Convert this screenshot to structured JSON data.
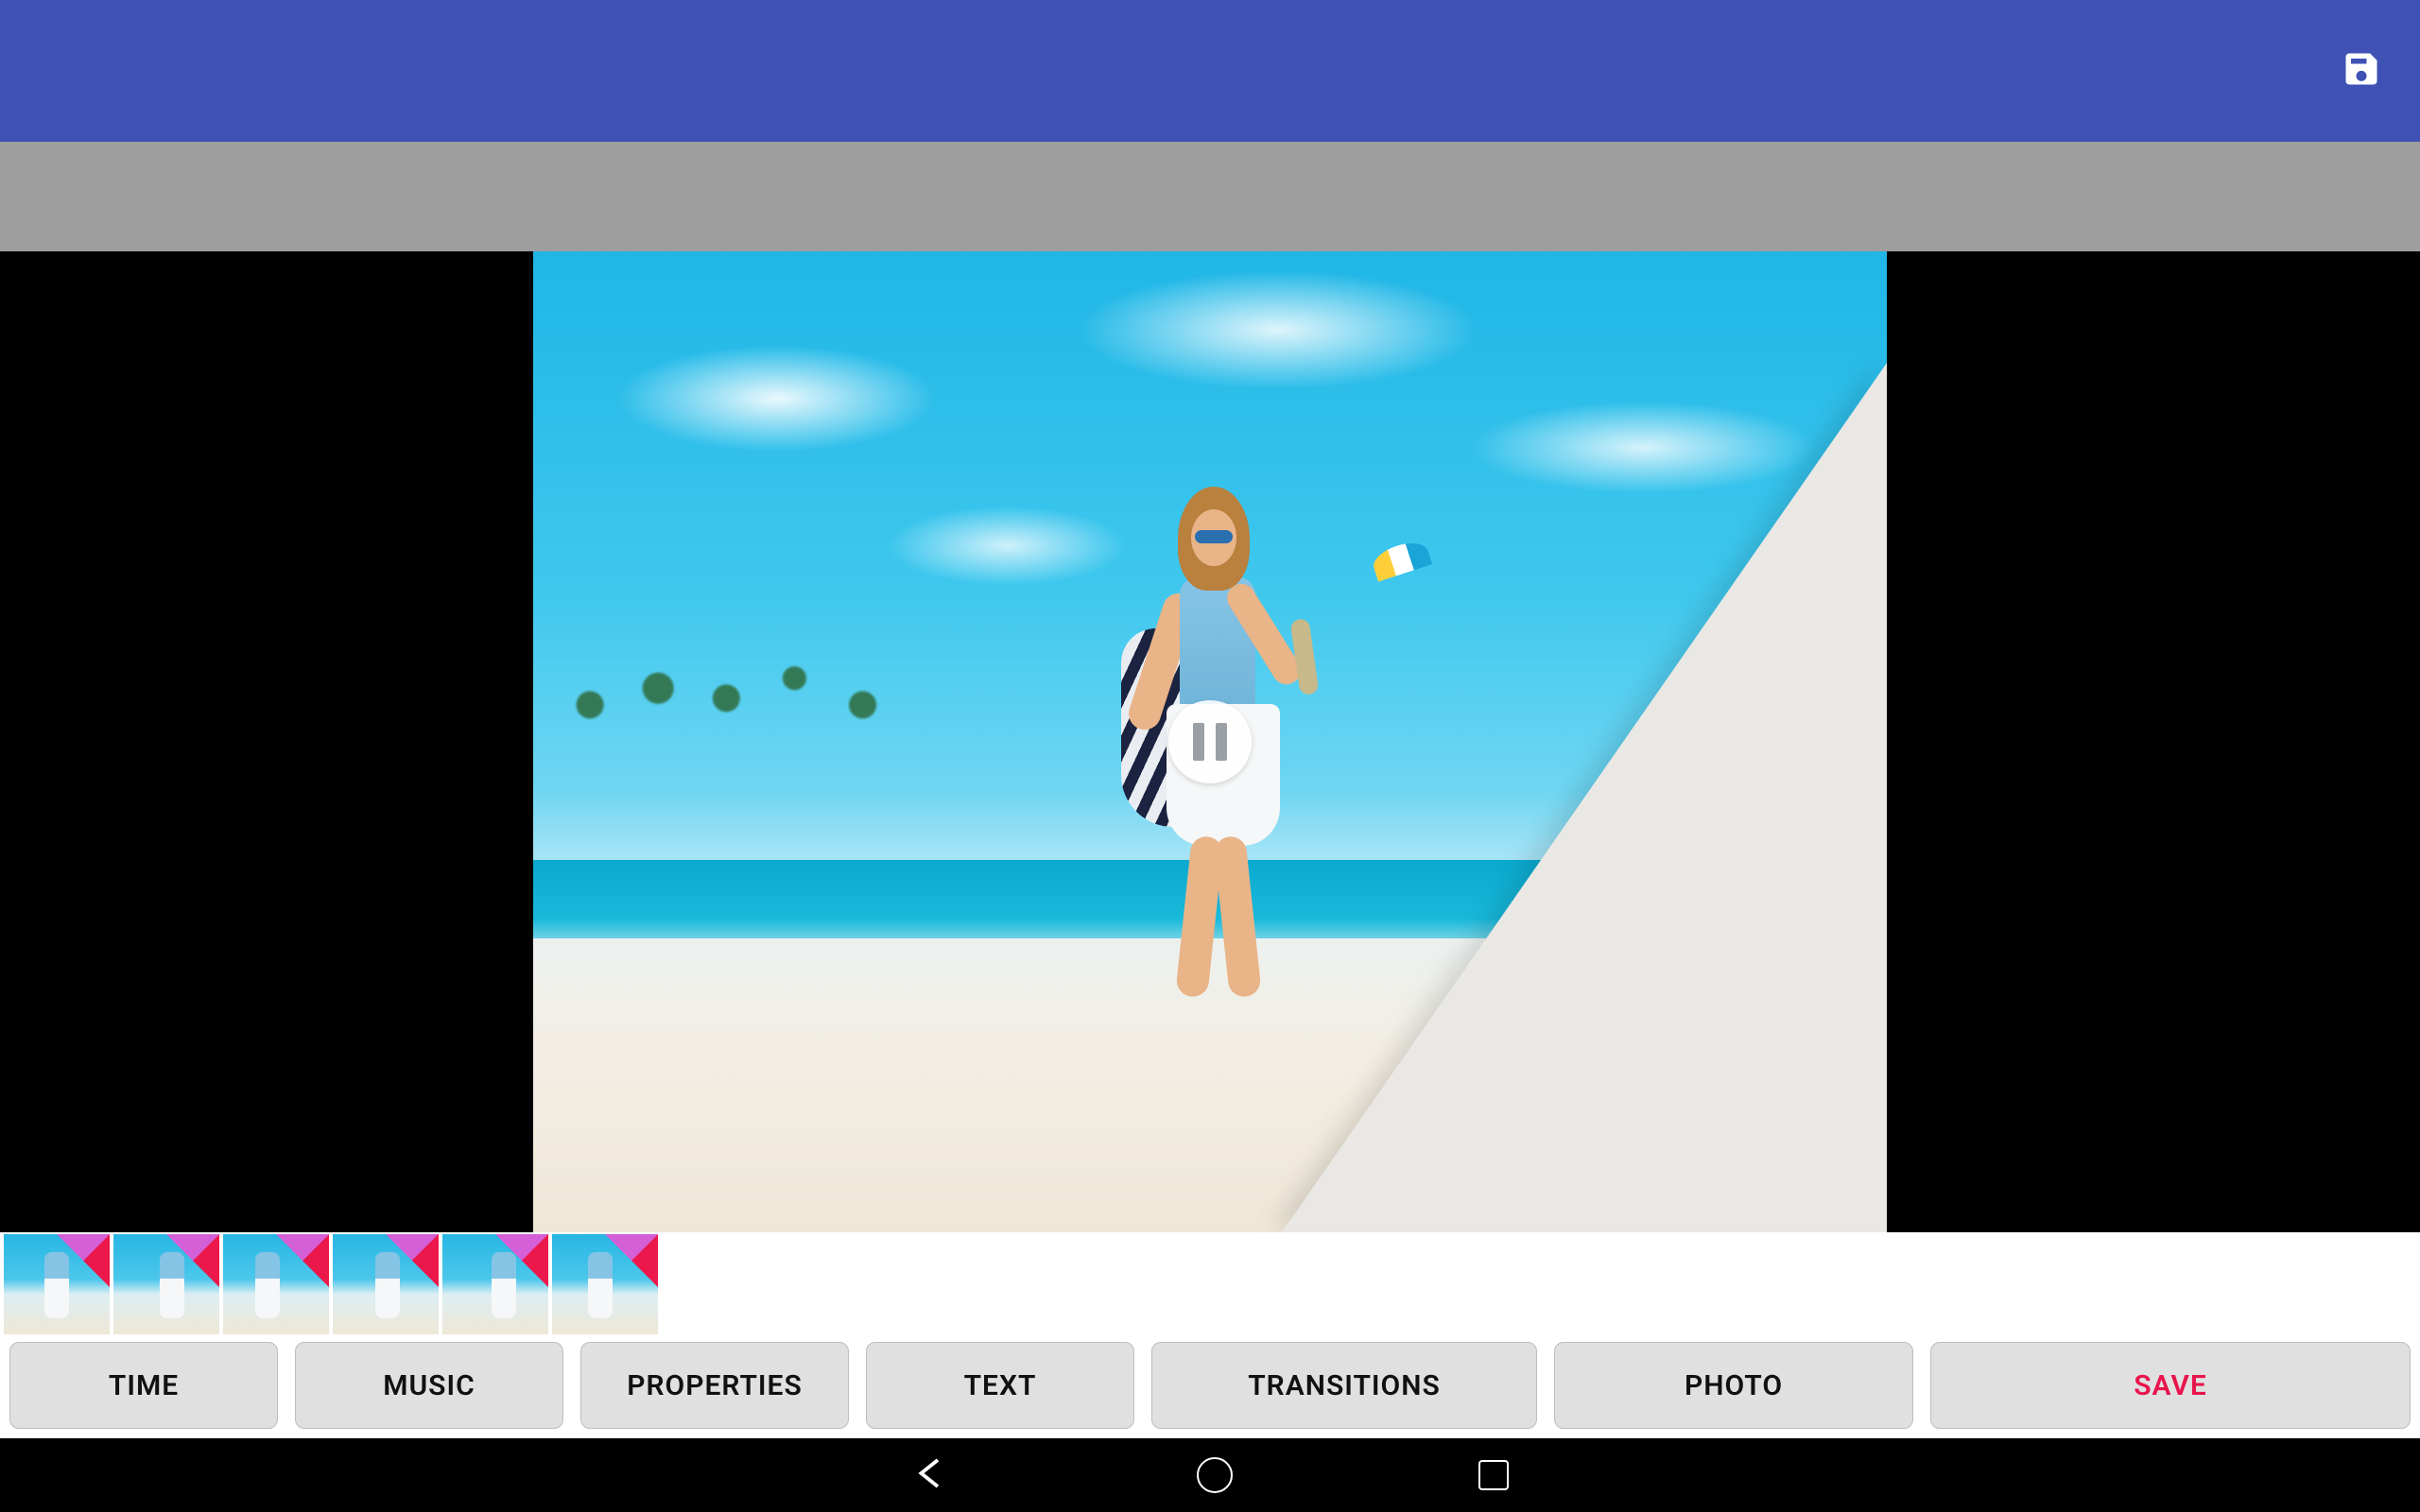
{
  "appbar": {
    "save_icon": "save-icon"
  },
  "preview": {
    "playback_state": "paused",
    "pause_icon": "pause-icon",
    "transition_effect": "page-curl"
  },
  "thumbnails": {
    "count": 6,
    "items": [
      {
        "index": 0,
        "has_transition_badge": true
      },
      {
        "index": 1,
        "has_transition_badge": true
      },
      {
        "index": 2,
        "has_transition_badge": true
      },
      {
        "index": 3,
        "has_transition_badge": true
      },
      {
        "index": 4,
        "has_transition_badge": true
      },
      {
        "index": 5,
        "has_transition_badge": true
      }
    ]
  },
  "toolbar": {
    "time_label": "TIME",
    "music_label": "MUSIC",
    "properties_label": "PROPERTIES",
    "text_label": "TEXT",
    "transitions_label": "TRANSITIONS",
    "photo_label": "PHOTO",
    "save_label": "SAVE"
  },
  "navbar": {
    "back_icon": "nav-back-icon",
    "home_icon": "nav-home-icon",
    "recents_icon": "nav-recents-icon"
  },
  "colors": {
    "appbar_bg": "#3f51b5",
    "graybar_bg": "#9e9e9e",
    "button_bg": "#e0e0e0",
    "save_text": "#e8144c"
  }
}
